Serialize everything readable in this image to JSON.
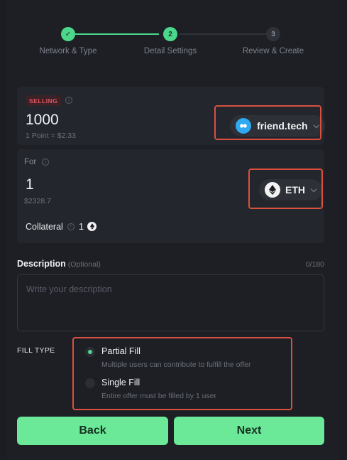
{
  "stepper": {
    "steps": [
      {
        "number": "✓",
        "label": "Network & Type"
      },
      {
        "number": "2",
        "label": "Detail Settings"
      },
      {
        "number": "3",
        "label": "Review & Create"
      }
    ]
  },
  "selling": {
    "badge": "SELLING",
    "amount": "1000",
    "rate": "1 Point = $2.33",
    "token": "friend.tech"
  },
  "for": {
    "label": "For",
    "amount": "1",
    "usd": "$2328.7",
    "token": "ETH"
  },
  "collateral": {
    "label": "Collateral",
    "value": "1"
  },
  "description": {
    "label": "Description",
    "optional": "(Optional)",
    "counter": "0/180",
    "placeholder": "Write your description"
  },
  "fill_type": {
    "label": "FILL TYPE",
    "options": [
      {
        "title": "Partial Fill",
        "desc": "Multiple users can contribute to fulfill the offer",
        "selected": true
      },
      {
        "title": "Single Fill",
        "desc": "Entire offer must be filled by 1 user",
        "selected": false
      }
    ]
  },
  "buttons": {
    "back": "Back",
    "next": "Next"
  },
  "colors": {
    "accent": "#4bd88b",
    "button": "#6ce899",
    "highlight": "#d9503e",
    "selling_badge": "#e35562"
  }
}
